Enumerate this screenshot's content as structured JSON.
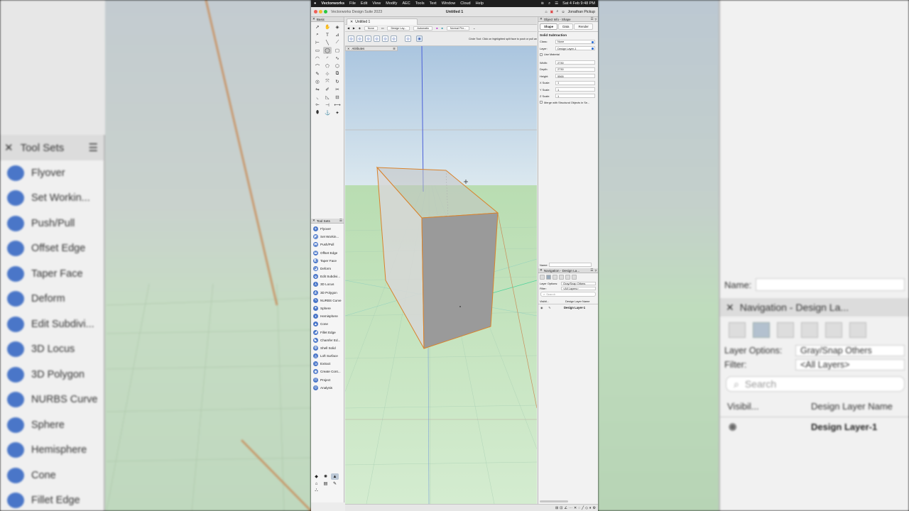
{
  "menu_bar": {
    "app_name": "Vectorworks",
    "items": [
      "File",
      "Edit",
      "View",
      "Modify",
      "AEC",
      "Tools",
      "Text",
      "Window",
      "Cloud",
      "Help"
    ],
    "clock": "Sat 4 Feb 9:48 PM"
  },
  "title_bar": {
    "app_title": "Vectorworks Design Suite 2023",
    "document_title": "Untitled 1",
    "user_name": "Jonathan Pickup"
  },
  "document_tab": {
    "label": "Untitled 1"
  },
  "view_bar": {
    "class_value": "None",
    "layer_value": "Design Lay...",
    "render_value": "Automatic",
    "view_value": "Normal Per..."
  },
  "mode_bar": {
    "hint": "Circle Tool: Click on highlighted split face to push or pull an extr..."
  },
  "attributes_palette": {
    "title": "Attributes"
  },
  "basic_palette": {
    "title": "Basic"
  },
  "tool_sets_palette": {
    "title": "Tool Sets",
    "items": [
      {
        "label": "Flyover"
      },
      {
        "label": "Set Workin..."
      },
      {
        "label": "Push/Pull"
      },
      {
        "label": "Offset Edge"
      },
      {
        "label": "Taper Face"
      },
      {
        "label": "Deform"
      },
      {
        "label": "Edit Subdivi..."
      },
      {
        "label": "3D Locus"
      },
      {
        "label": "3D Polygon"
      },
      {
        "label": "NURBS Curve"
      },
      {
        "label": "Sphere"
      },
      {
        "label": "Hemisphere"
      },
      {
        "label": "Cone"
      },
      {
        "label": "Fillet Edge"
      },
      {
        "label": "Chamfer Ed..."
      },
      {
        "label": "Shell Solid"
      },
      {
        "label": "Loft Surface"
      },
      {
        "label": "Extract"
      },
      {
        "label": "Create Cont..."
      },
      {
        "label": "Project"
      },
      {
        "label": "Analysis"
      }
    ]
  },
  "object_info": {
    "title": "Object Info - Shape",
    "tabs": [
      "Shape",
      "Data",
      "Render"
    ],
    "object_type": "Solid Subtraction",
    "class_label": "Class:",
    "class_value": "None",
    "layer_label": "Layer:",
    "layer_value": "Design Layer-1",
    "use_material": "Use Material",
    "width_label": "Width:",
    "width_value": "2730",
    "depth_label": "Depth:",
    "depth_value": "2730",
    "height_label": "Height:",
    "height_value": "5565",
    "xscale_label": "X Scale:",
    "xscale_value": "1",
    "yscale_label": "Y Scale:",
    "yscale_value": "1",
    "zscale_label": "Z Scale:",
    "zscale_value": "1",
    "merge_label": "Merge with Structural Objects in Se...",
    "name_label": "Name:"
  },
  "navigation": {
    "title": "Navigation - Design La...",
    "layer_options_label": "Layer Options:",
    "layer_options_value": "Gray/Snap Others",
    "filter_label": "Filter:",
    "filter_value": "<All Layers>",
    "search_placeholder": "Search",
    "col_visibility": "Visibil...",
    "col_name": "Design Layer Name",
    "layers": [
      {
        "name": "Design Layer-1"
      }
    ]
  },
  "background_mirror": {
    "tool_sets_title": "Tool Sets",
    "name_label": "Name:",
    "nav_title": "Navigation - Design La...",
    "layer_options_label": "Layer Options:",
    "layer_options_value": "Gray/Snap Others",
    "filter_label": "Filter:",
    "filter_value": "<All Layers>",
    "search_placeholder": "Search",
    "col_visibility": "Visibil...",
    "col_name": "Design Layer Name",
    "layer_name": "Design Layer-1"
  },
  "colors": {
    "sky_top": "#b7cde2",
    "ground": "#c7e3c4",
    "selection": "#d9822b",
    "accent": "#2f6fd4"
  }
}
